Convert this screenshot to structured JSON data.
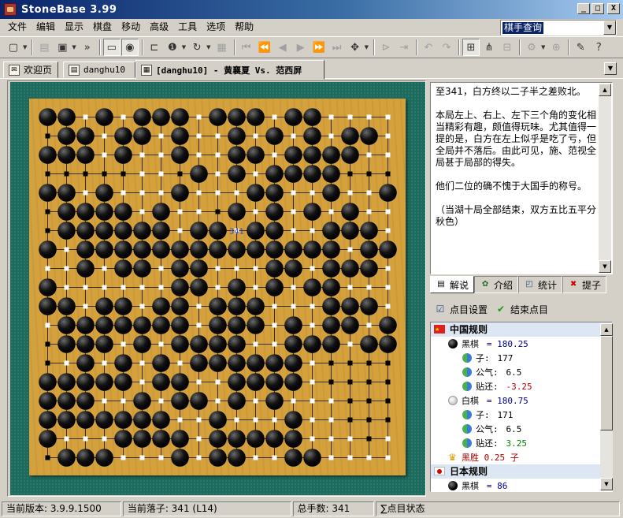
{
  "window": {
    "title": "StoneBase 3.99",
    "buttons": [
      "_",
      "□",
      "X"
    ]
  },
  "menu": [
    "文件",
    "编辑",
    "显示",
    "棋盘",
    "移动",
    "高级",
    "工具",
    "选项",
    "帮助"
  ],
  "query_box": {
    "value": "棋手查询"
  },
  "tabs": [
    {
      "label": "欢迎页",
      "icon": "welcome-icon"
    },
    {
      "label": "danghu10",
      "icon": "database-icon"
    },
    {
      "label": "[danghu10] - 黄襄夏 Vs. 范西屏",
      "icon": "board-icon",
      "active": true
    }
  ],
  "board": {
    "size": 19,
    "last_move_label": "341",
    "board_color": "#d4a13c",
    "felt_color": "#1e6b5e",
    "rows": [
      "BBwBwBBBwBBBwBBwwww",
      "bBBwBBwBwwBwBwBwBBw",
      "BBBwBwwBwwBBwBBBBww",
      "bbbbbwwbBwBwBBBBbbb",
      "BBwBwwwBwwwBBwwBwwB",
      "bBBBBwBwwbBwBwBwBww",
      "bBBBBBBwBBwBBwwBBBw",
      "BwBBBBBBBBBBBBBBwBB",
      "wwBwBBwBBwwwBBwBBBw",
      "BwwwwwwBBwBwBwBBwww",
      "BBwBBwBBwBBBwwwBBBw",
      "wBBBBBBBwBBBwBwBBwB",
      "bBBBwBwBBBBwwBBBwBB",
      "bwBwBwBwBBBBBBwbbbb",
      "BBBBBwBBwwBBBBwbbbb",
      "BBBwwBwBBwBwBwwwbbb",
      "BBBBBBBwwBwwwBwwbbb",
      "BwwwBBBBwBBBBBwwwbw",
      "bBBBwwwBwBBwwBBwwww"
    ]
  },
  "comment": {
    "paragraphs": [
      "至341，白方终以二子半之差败北。",
      "本局左上、右上、左下三个角的变化相当精彩有趣，颇值得玩味。尤其值得一提的是，白方在左上似乎是吃了亏，但全局并不落后。由此可见，施、范视全局甚于局部的得失。",
      "他们二位的确不愧于大国手的称号。",
      "（当湖十局全部结束，双方五比五平分秋色）"
    ]
  },
  "panel_tabs": [
    {
      "label": "解说",
      "icon": "comment-icon",
      "active": true
    },
    {
      "label": "介绍",
      "icon": "info-icon"
    },
    {
      "label": "统计",
      "icon": "stats-icon"
    },
    {
      "label": "提子",
      "icon": "capture-icon"
    }
  ],
  "score_actions": {
    "settings": "点目设置",
    "finish": "结束点目"
  },
  "score_tree": {
    "chinese_rules": "中国规则",
    "black_label": "黑棋",
    "black_total": "= 180.25",
    "black_stones_label": "子:",
    "black_stones": "177",
    "black_public_label": "公气:",
    "black_public": "6.5",
    "black_komi_label": "贴还:",
    "black_komi": "-3.25",
    "white_label": "白棋",
    "white_total": "= 180.75",
    "white_stones_label": "子:",
    "white_stones": "171",
    "white_public_label": "公气:",
    "white_public": "6.5",
    "white_komi_label": "贴还:",
    "white_komi": "3.25",
    "result": "黑胜 0.25 子",
    "japanese_rules": "日本规则",
    "jp_black_label": "黑棋",
    "jp_black_total": "= 86"
  },
  "status": {
    "version": "当前版本: 3.9.9.1500",
    "current_move": "当前落子: 341 (L14)",
    "total_moves": "总手数: 341",
    "scoring": "∑点目状态"
  },
  "colors": {
    "title_gradient_start": "#0a246a",
    "board": "#d4a13c",
    "felt": "#1e6b5e",
    "territory_black": "#000000",
    "territory_white": "#ffffff",
    "marker_red": "#e00000",
    "result_text": "#b00000",
    "komi_black": "#c00000",
    "komi_white": "#008000"
  }
}
